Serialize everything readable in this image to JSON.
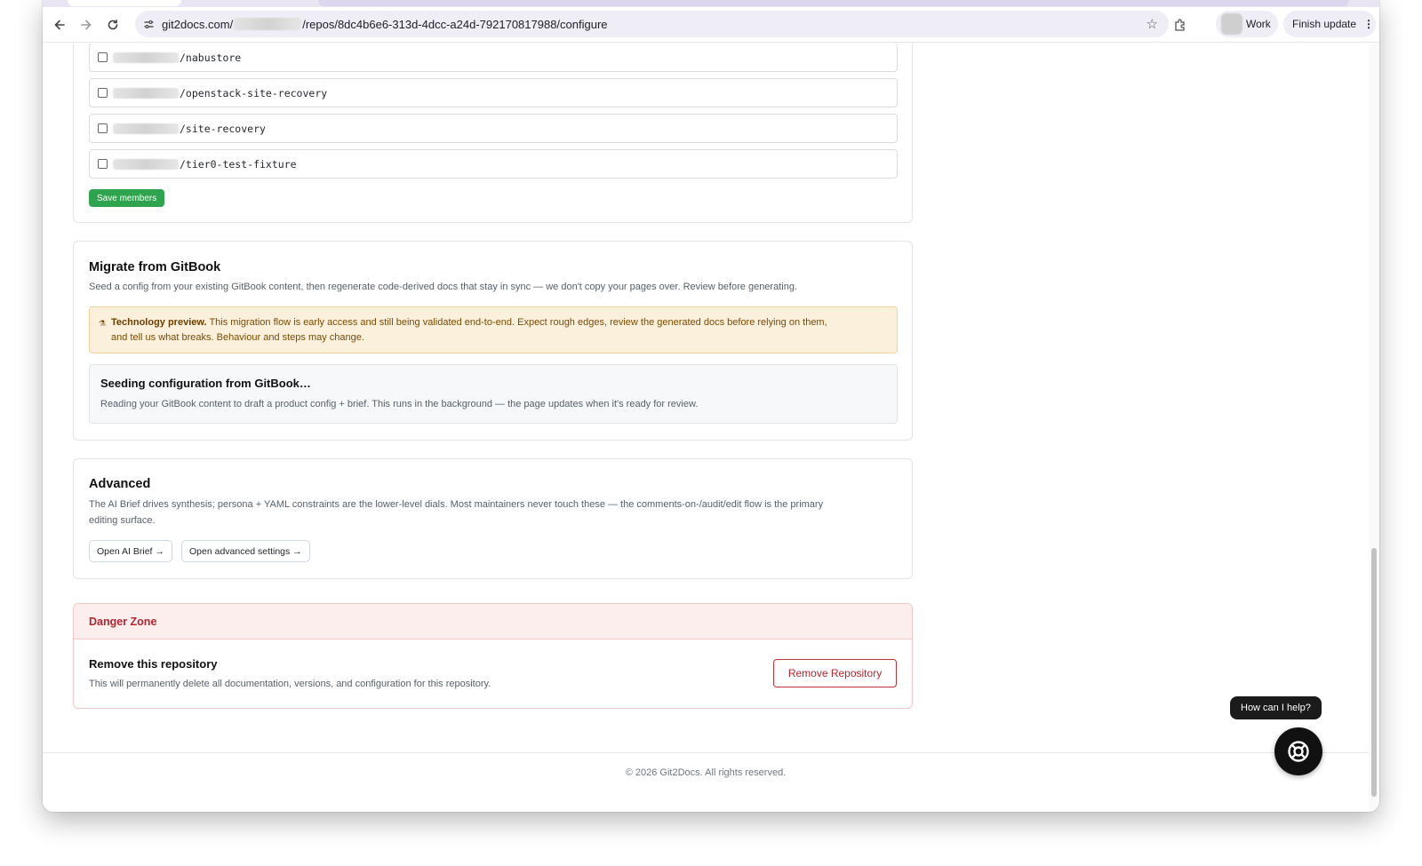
{
  "browser": {
    "url_domain": "git2docs.com/",
    "url_path": "/repos/8dc4b6e6-313d-4dcc-a24d-792170817988/configure",
    "profile_label": "Work",
    "finish_update_label": "Finish update"
  },
  "members": {
    "items": [
      {
        "name": "/nabustore"
      },
      {
        "name": "/openstack-site-recovery"
      },
      {
        "name": "/site-recovery"
      },
      {
        "name": "/tier0-test-fixture"
      }
    ],
    "save_label": "Save members"
  },
  "migrate": {
    "title": "Migrate from GitBook",
    "description": "Seed a config from your existing GitBook content, then regenerate code-derived docs that stay in sync — we don't copy your pages over. Review before generating.",
    "preview_bold": "Technology preview.",
    "preview_text": "This migration flow is early access and still being validated end-to-end. Expect rough edges, review the generated docs before relying on them,",
    "preview_text2": "and tell us what breaks. Behaviour and steps may change.",
    "seeding_title": "Seeding configuration from GitBook…",
    "seeding_text": "Reading your GitBook content to draft a product config + brief. This runs in the background — the page updates when it's ready for review."
  },
  "advanced": {
    "title": "Advanced",
    "description_line1": "The AI Brief drives synthesis; persona + YAML constraints are the lower-level dials. Most maintainers never touch these — the comments-on-/audit/edit flow is the primary",
    "description_line2": "editing surface.",
    "brief_button": "Open AI Brief →",
    "settings_button": "Open advanced settings →"
  },
  "danger": {
    "header": "Danger Zone",
    "title": "Remove this repository",
    "description": "This will permanently delete all documentation, versions, and configuration for this repository.",
    "button": "Remove Repository"
  },
  "footer": {
    "text": "© 2026 Git2Docs. All rights reserved."
  },
  "help": {
    "tooltip": "How can I help?"
  },
  "colors": {
    "save_green": "#2ea44f",
    "danger_red": "#b3262e",
    "warning_bg": "#fbf0dc"
  }
}
